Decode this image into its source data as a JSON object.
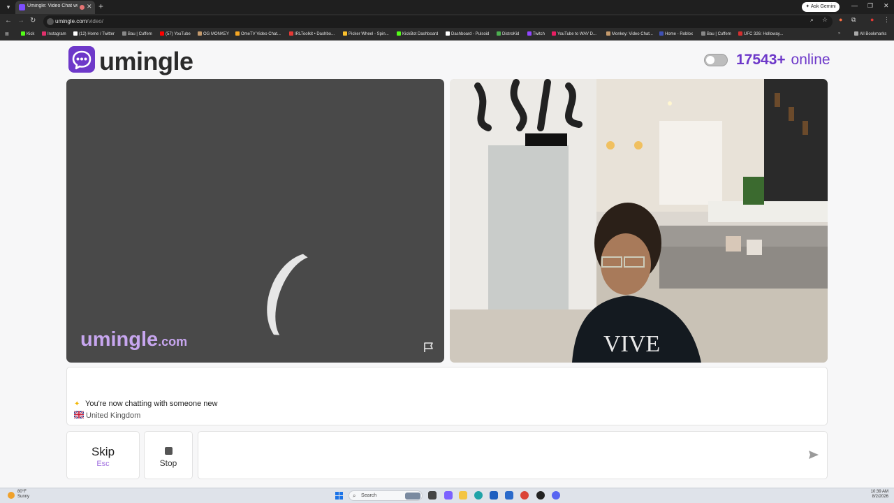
{
  "browser": {
    "tab_title": "Umingle: Video Chat with S",
    "new_tab": "+",
    "tab_close": "✕",
    "ask_gemini": "Ask Gemini",
    "url_domain": "umingle.com",
    "url_path": "/video/",
    "all_bookmarks": "All Bookmarks",
    "bookmarks": [
      {
        "label": "Kick",
        "color": "#53fc18"
      },
      {
        "label": "Instagram",
        "color": "#e1306c"
      },
      {
        "label": "(12) Home / Twitter",
        "color": "#ffffff"
      },
      {
        "label": "Bau | Cuffem",
        "color": "#888888"
      },
      {
        "label": "(57) YouTube",
        "color": "#ff0000"
      },
      {
        "label": "OG MONKEY",
        "color": "#c49a6c"
      },
      {
        "label": "OmeTV Video Chat...",
        "color": "#f5a623"
      },
      {
        "label": "IRLToolkit • Dashbo...",
        "color": "#e53935"
      },
      {
        "label": "Picker Wheel - Spin...",
        "color": "#fbc02d"
      },
      {
        "label": "KickBot Dashboard",
        "color": "#53fc18"
      },
      {
        "label": "Dashboard - Pulsoid",
        "color": "#ffffff"
      },
      {
        "label": "DistroKid",
        "color": "#4caf50"
      },
      {
        "label": "Twitch",
        "color": "#9146ff"
      },
      {
        "label": "YouTube to WAV D...",
        "color": "#e91e63"
      },
      {
        "label": "Monkey: Video Chat...",
        "color": "#c49a6c"
      },
      {
        "label": "Home - Roblox",
        "color": "#3f51b5"
      },
      {
        "label": "Bau | Cuffem",
        "color": "#888888"
      },
      {
        "label": "UFC 326: Holloway...",
        "color": "#d32f2f"
      }
    ]
  },
  "header": {
    "logo_text": "umingle",
    "online_count": "17543+",
    "online_label": "online"
  },
  "video": {
    "watermark": "umingle",
    "watermark_suffix": ".com"
  },
  "chat": {
    "status_message": "You're now chatting with someone new",
    "country": "United Kingdom"
  },
  "controls": {
    "skip_label": "Skip",
    "skip_shortcut": "Esc",
    "stop_label": "Stop",
    "message_placeholder": ""
  },
  "taskbar": {
    "weather_temp": "80°F",
    "weather_desc": "Sunny",
    "search_label": "Search",
    "time": "10:39 AM",
    "date": "8/2/2026"
  }
}
